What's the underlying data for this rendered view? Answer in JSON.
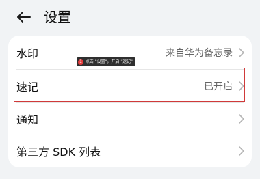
{
  "header": {
    "back_icon": "back-arrow-icon",
    "title": "设置"
  },
  "settings": {
    "rows": [
      {
        "label": "水印",
        "value": "来自华为备忘录"
      },
      {
        "label": "速记",
        "value": "已开启"
      },
      {
        "label": "通知",
        "value": ""
      },
      {
        "label": "第三方 SDK 列表",
        "value": ""
      }
    ]
  },
  "annotation": {
    "step_number": "1",
    "text": "点击 \"设置\"，开启 \"速记\"",
    "highlight_color": "#d03a3a"
  },
  "colors": {
    "background": "#f1f3f5",
    "card": "#ffffff",
    "text_primary": "#111111",
    "text_secondary": "#666666"
  }
}
